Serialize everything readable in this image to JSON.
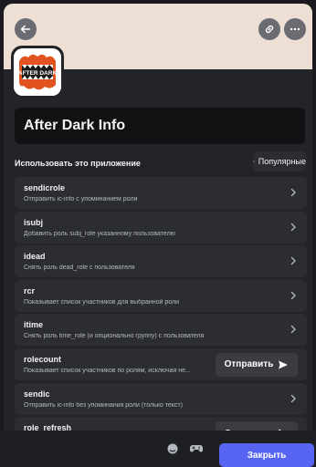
{
  "app": {
    "name": "After Dark Info",
    "avatar_text": "AFTER DARK"
  },
  "section": {
    "label": "Использовать это приложение",
    "sort_label": "Популярные"
  },
  "commands": [
    {
      "name": "sendicrole",
      "desc": "Отправить ic-info с упоминанием роли",
      "action": "chevron"
    },
    {
      "name": "isubj",
      "desc": "Добавить роль subj_role указанному пользователю",
      "action": "chevron"
    },
    {
      "name": "idead",
      "desc": "Снять роль dead_role с пользователя",
      "action": "chevron"
    },
    {
      "name": "rcr",
      "desc": "Показывает список участников для выбранной роли",
      "action": "chevron"
    },
    {
      "name": "itime",
      "desc": "Снять роль time_role (и опционально группу) с пользователя",
      "action": "chevron"
    },
    {
      "name": "rolecount",
      "desc": "Показывает список участников по ролям, исключая не...",
      "action": "send"
    },
    {
      "name": "sendic",
      "desc": "Отправить ic-info без упоминания роли (только текст)",
      "action": "chevron"
    },
    {
      "name": "role_refresh",
      "desc": "",
      "action": "send"
    }
  ],
  "send_label": "Отправить",
  "close_label": "Закрыть",
  "colors": {
    "banner": "#eddfd4",
    "accent": "#5865f2",
    "panel": "#232428"
  },
  "icons": {
    "back": "arrow-left-icon",
    "link": "link-icon",
    "more": "more-dots-icon",
    "sort": "sort-arrows-icon",
    "chevron": "chevron-right-icon",
    "send": "paper-plane-icon",
    "emoji": "emoji-icon",
    "gamepad": "gamepad-icon"
  }
}
